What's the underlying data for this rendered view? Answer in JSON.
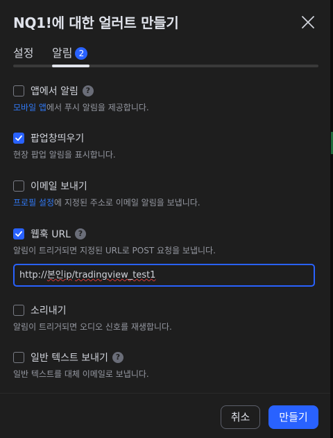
{
  "dialog": {
    "title": "NQ1!에 대한 얼러트 만들기",
    "close_icon": "close-icon"
  },
  "tabs": [
    {
      "label": "설정",
      "active": false
    },
    {
      "label": "알림",
      "active": true,
      "badge": "2"
    }
  ],
  "options": {
    "app": {
      "label": "앱에서 알림",
      "checked": false,
      "has_help": true,
      "desc_link": "모바일 앱",
      "desc_text": "에서 푸시 알림을 제공합니다."
    },
    "popup": {
      "label": "팝업창띄우기",
      "checked": true,
      "desc_text": "현장 팝업 알림을 표시합니다."
    },
    "email": {
      "label": "이메일 보내기",
      "checked": false,
      "desc_link": "프로필 설정",
      "desc_text": "에 지정된 주소로 이메일 알림을 보냅니다."
    },
    "webhook": {
      "label": "웹훅 URL",
      "checked": true,
      "has_help": true,
      "desc_text": "알림이 트리거되면 지정된 URL로 POST 요청을 보냅니다.",
      "url_prefix": "http://",
      "url_spell": "본인ip",
      "url_mid": "/",
      "url_suffix": "tradingview_test1"
    },
    "sound": {
      "label": "소리내기",
      "checked": false,
      "desc_text": "알림이 트리거되면 오디오 신호를 재생합니다."
    },
    "plaintext": {
      "label": "일반 텍스트 보내기",
      "checked": false,
      "has_help": true,
      "desc_text": "일반 텍스트를 대체 이메일로 보냅니다."
    }
  },
  "footer": {
    "cancel_label": "취소",
    "create_label": "만들기"
  },
  "colors": {
    "accent": "#2962ff",
    "link": "#3179f5",
    "background": "#1e1e1e"
  }
}
